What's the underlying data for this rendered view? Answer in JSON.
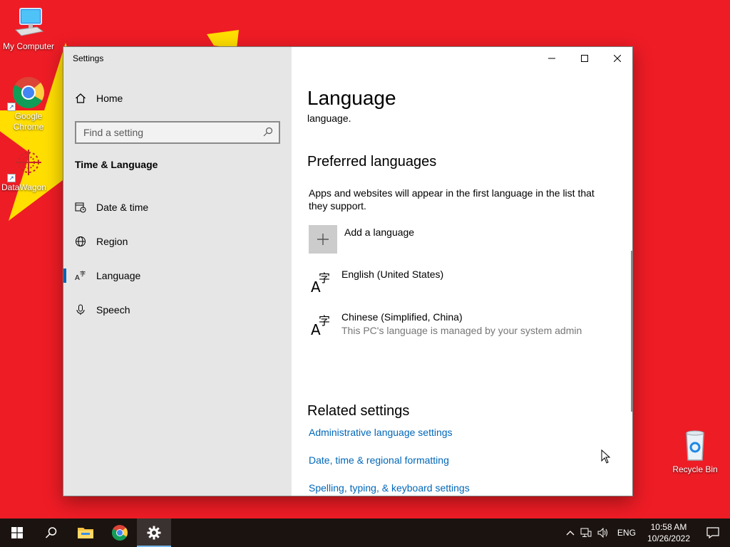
{
  "desktop": {
    "icons": [
      {
        "label": "My Computer"
      },
      {
        "label": "Google Chrome"
      },
      {
        "label": "DataWagon"
      },
      {
        "label": "Recycle Bin"
      }
    ]
  },
  "window": {
    "title": "Settings",
    "nav": {
      "home": "Home",
      "search_placeholder": "Find a setting",
      "section": "Time & Language",
      "items": [
        {
          "label": "Date & time"
        },
        {
          "label": "Region"
        },
        {
          "label": "Language"
        },
        {
          "label": "Speech"
        }
      ]
    },
    "content": {
      "title": "Language",
      "fragment": "language.",
      "preferred_heading": "Preferred languages",
      "preferred_desc": "Apps and websites will appear in the first language in the list that they support.",
      "add_language": "Add a language",
      "languages": [
        {
          "name": "English (United States)",
          "note": ""
        },
        {
          "name": "Chinese (Simplified, China)",
          "note": "This PC's language is managed by your system admin"
        }
      ],
      "related_heading": "Related settings",
      "related_links": [
        {
          "label": "Administrative language settings"
        },
        {
          "label": "Date, time & regional formatting"
        },
        {
          "label": "Spelling, typing, & keyboard settings"
        }
      ]
    }
  },
  "taskbar": {
    "tray": {
      "language": "ENG",
      "time": "10:58 AM",
      "date": "10/26/2022"
    }
  },
  "colors": {
    "wallpaper": "#ee1c25",
    "star": "#ffde00",
    "accent": "#0063b1",
    "link": "#0067b8"
  }
}
